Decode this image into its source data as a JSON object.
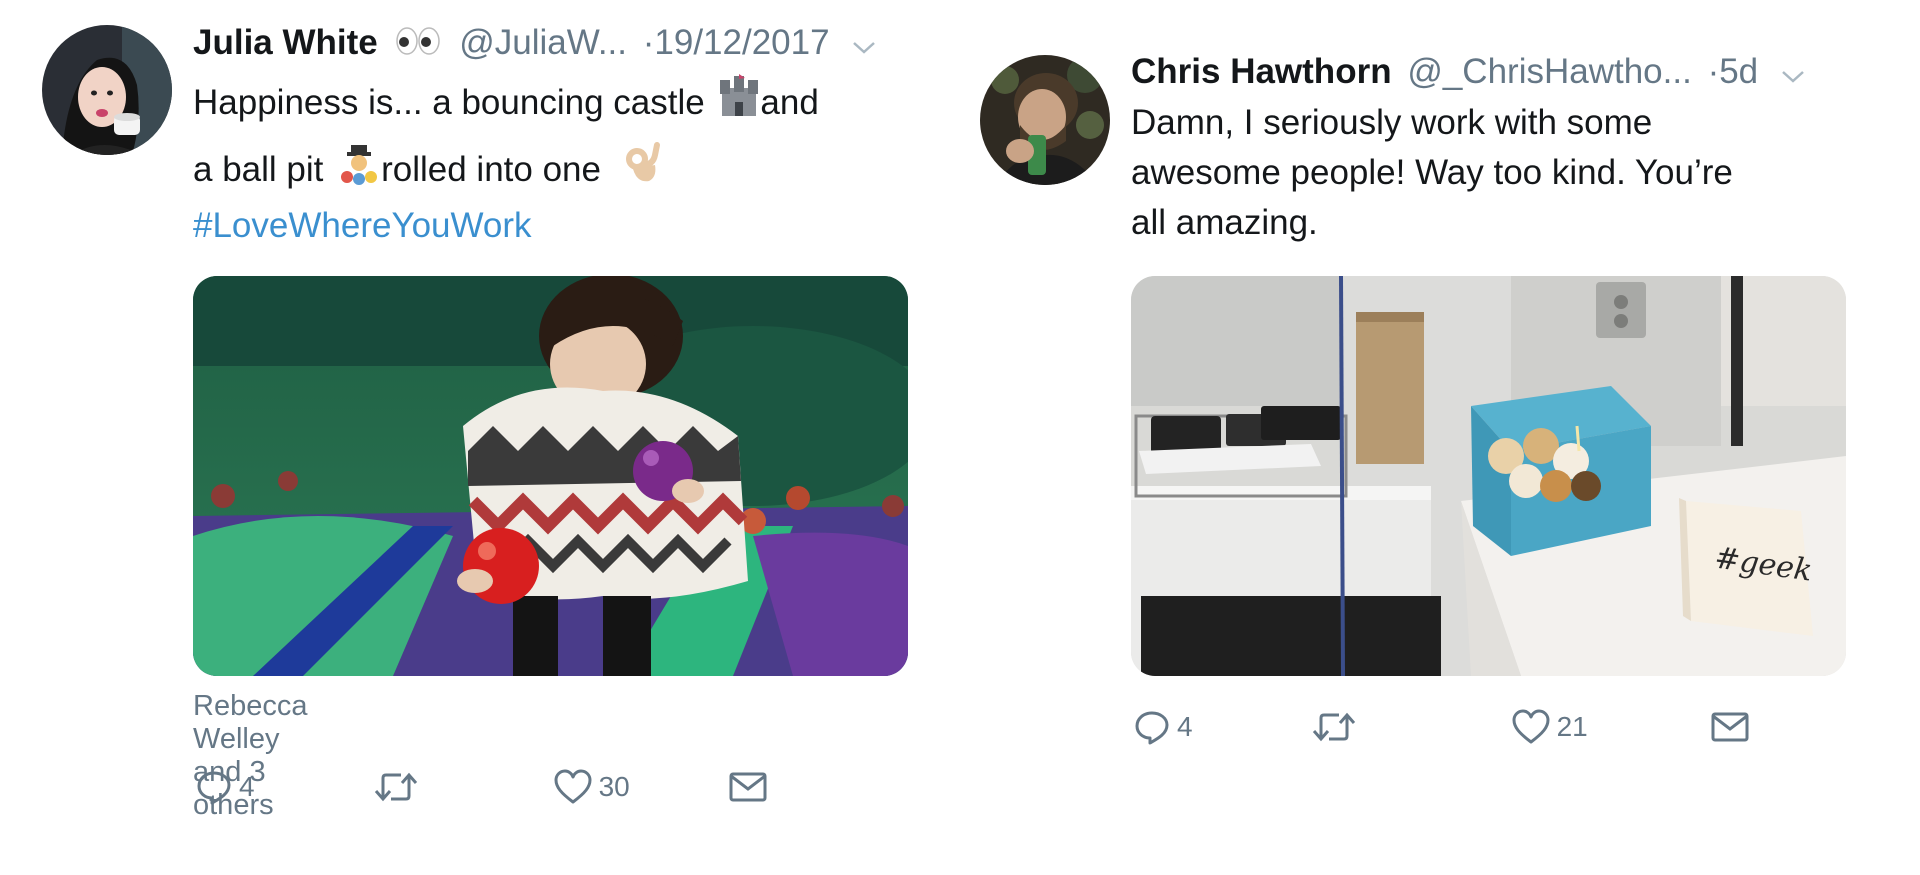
{
  "tweets": [
    {
      "name": "Julia White",
      "handle": "@JuliaW...",
      "separator": "·",
      "time": "19/12/2017",
      "text_lines": [
        "Happiness is... a bouncing castle",
        "and",
        "a ball pit",
        "rolled into one"
      ],
      "hashtag": "#LoveWhereYouWork",
      "liked_by": "Rebecca Welley and 3 others",
      "reply_count": "4",
      "retweet_count": "",
      "like_count": "30",
      "icons": [
        "eyes-emoji",
        "castle-emoji",
        "ball-pit-emoji",
        "ok-hand-emoji",
        "chevron-down-icon",
        "reply-icon",
        "retweet-icon",
        "heart-icon",
        "mail-icon"
      ]
    },
    {
      "name": "Chris Hawthorn",
      "handle": "@_ChrisHawtho...",
      "separator": "·",
      "time": "5d",
      "text_lines": [
        "Damn, I seriously work with some",
        "awesome people! Way too kind. You’re",
        "all amazing."
      ],
      "card_text": "#geek",
      "reply_count": "4",
      "retweet_count": "",
      "like_count": "21",
      "icons": [
        "chevron-down-icon",
        "reply-icon",
        "retweet-icon",
        "heart-icon",
        "mail-icon"
      ]
    }
  ],
  "colors": {
    "text": "#14171a",
    "secondary": "#657786",
    "hashtag": "#3a8fcf"
  }
}
